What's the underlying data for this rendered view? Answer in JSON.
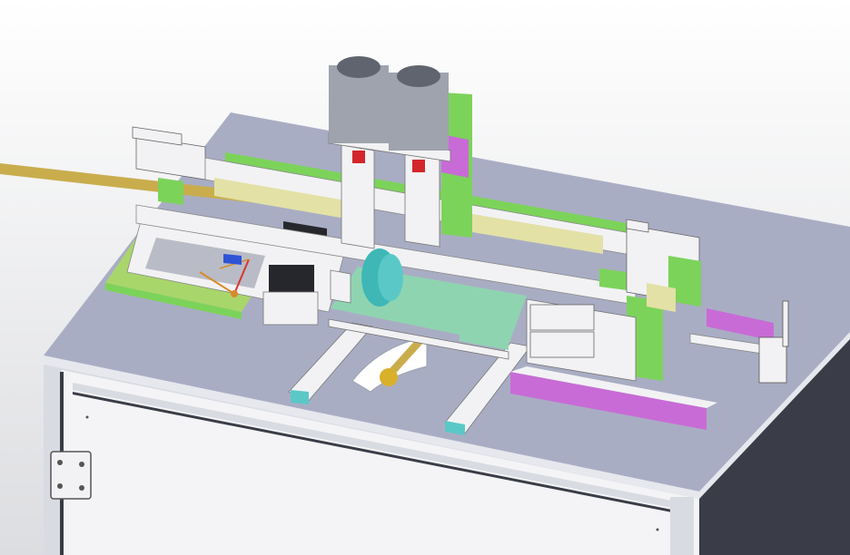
{
  "view": {
    "background_top": "#ffffff",
    "background_bottom": "#dcdde0"
  },
  "palette": {
    "table_top": "#a9adc4",
    "table_edge": "#e6e8ee",
    "cabinet_panel": "#f4f4f6",
    "cabinet_frame": "#d9dbe2",
    "cabinet_dark": "#3a3d47",
    "plate_white": "#f2f2f4",
    "plate_shadow": "#b9bcc6",
    "green_plate": "#a9d66b",
    "green_bright": "#7cd35a",
    "mint_plate": "#8fd4b1",
    "cyan_part": "#5bc8c8",
    "teal_part": "#3fb7b7",
    "purple_part": "#c86bd6",
    "yellow_rail": "#e3e1a6",
    "rod_gold": "#c9ad4d",
    "gold_knob": "#d9b02a",
    "cylinder_gray": "#9ea3ad",
    "cylinder_dark": "#5f646e",
    "black_part": "#25272c",
    "red_part": "#d3262b",
    "blue_part": "#2f53d6",
    "axis_red": "#d9352b",
    "axis_orange": "#d98a2b"
  },
  "icons": {
    "triad": "coordinate-triad-icon",
    "hinge": "door-hinge-icon"
  }
}
